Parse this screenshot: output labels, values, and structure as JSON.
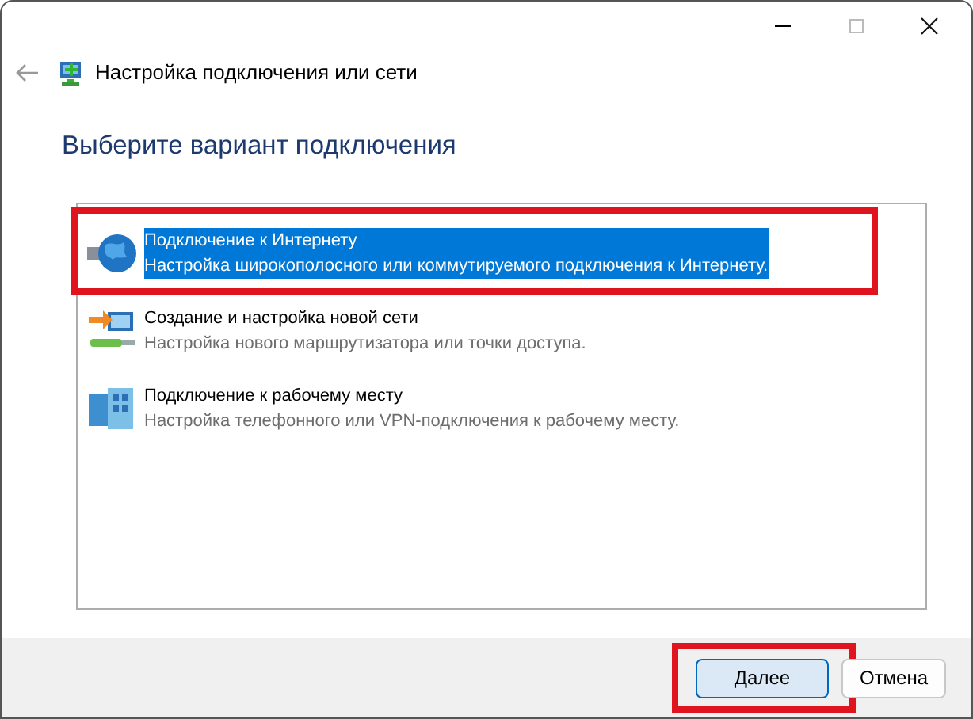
{
  "window": {
    "title": "Настройка подключения или сети"
  },
  "heading": "Выберите вариант подключения",
  "options": [
    {
      "kind": "internet",
      "title": "Подключение к Интернету",
      "description": "Настройка широкополосного или коммутируемого подключения к Интернету.",
      "selected": true,
      "annotated": true
    },
    {
      "kind": "new-network",
      "title": "Создание и настройка новой сети",
      "description": "Настройка нового маршрутизатора или точки доступа.",
      "selected": false,
      "annotated": false
    },
    {
      "kind": "workplace",
      "title": "Подключение к рабочему месту",
      "description": "Настройка телефонного или VPN-подключения к рабочему месту.",
      "selected": false,
      "annotated": false
    }
  ],
  "buttons": [
    {
      "label": "Далее",
      "default": true,
      "annotated": true
    },
    {
      "label": "Отмена",
      "default": false,
      "annotated": false
    }
  ]
}
